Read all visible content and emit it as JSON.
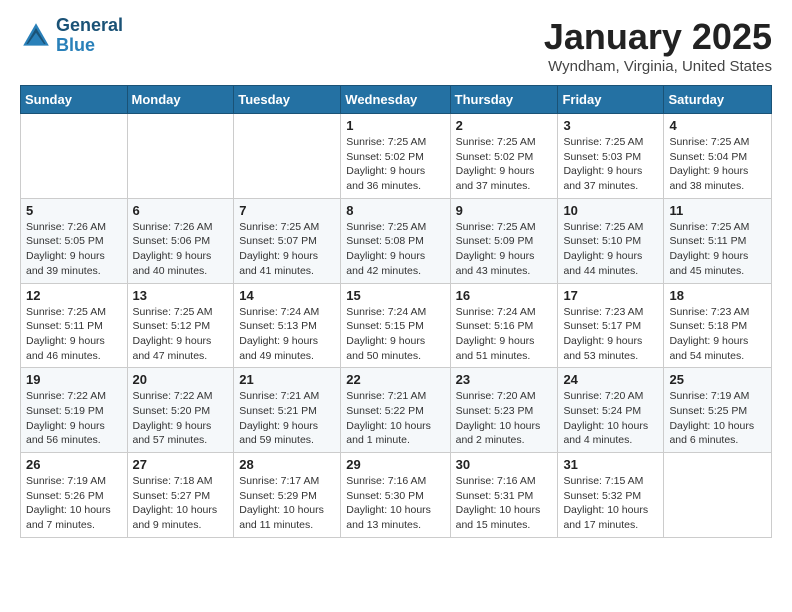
{
  "header": {
    "logo_line1": "General",
    "logo_line2": "Blue",
    "month": "January 2025",
    "location": "Wyndham, Virginia, United States"
  },
  "weekdays": [
    "Sunday",
    "Monday",
    "Tuesday",
    "Wednesday",
    "Thursday",
    "Friday",
    "Saturday"
  ],
  "weeks": [
    [
      {
        "day": "",
        "info": ""
      },
      {
        "day": "",
        "info": ""
      },
      {
        "day": "",
        "info": ""
      },
      {
        "day": "1",
        "info": "Sunrise: 7:25 AM\nSunset: 5:02 PM\nDaylight: 9 hours\nand 36 minutes."
      },
      {
        "day": "2",
        "info": "Sunrise: 7:25 AM\nSunset: 5:02 PM\nDaylight: 9 hours\nand 37 minutes."
      },
      {
        "day": "3",
        "info": "Sunrise: 7:25 AM\nSunset: 5:03 PM\nDaylight: 9 hours\nand 37 minutes."
      },
      {
        "day": "4",
        "info": "Sunrise: 7:25 AM\nSunset: 5:04 PM\nDaylight: 9 hours\nand 38 minutes."
      }
    ],
    [
      {
        "day": "5",
        "info": "Sunrise: 7:26 AM\nSunset: 5:05 PM\nDaylight: 9 hours\nand 39 minutes."
      },
      {
        "day": "6",
        "info": "Sunrise: 7:26 AM\nSunset: 5:06 PM\nDaylight: 9 hours\nand 40 minutes."
      },
      {
        "day": "7",
        "info": "Sunrise: 7:25 AM\nSunset: 5:07 PM\nDaylight: 9 hours\nand 41 minutes."
      },
      {
        "day": "8",
        "info": "Sunrise: 7:25 AM\nSunset: 5:08 PM\nDaylight: 9 hours\nand 42 minutes."
      },
      {
        "day": "9",
        "info": "Sunrise: 7:25 AM\nSunset: 5:09 PM\nDaylight: 9 hours\nand 43 minutes."
      },
      {
        "day": "10",
        "info": "Sunrise: 7:25 AM\nSunset: 5:10 PM\nDaylight: 9 hours\nand 44 minutes."
      },
      {
        "day": "11",
        "info": "Sunrise: 7:25 AM\nSunset: 5:11 PM\nDaylight: 9 hours\nand 45 minutes."
      }
    ],
    [
      {
        "day": "12",
        "info": "Sunrise: 7:25 AM\nSunset: 5:11 PM\nDaylight: 9 hours\nand 46 minutes."
      },
      {
        "day": "13",
        "info": "Sunrise: 7:25 AM\nSunset: 5:12 PM\nDaylight: 9 hours\nand 47 minutes."
      },
      {
        "day": "14",
        "info": "Sunrise: 7:24 AM\nSunset: 5:13 PM\nDaylight: 9 hours\nand 49 minutes."
      },
      {
        "day": "15",
        "info": "Sunrise: 7:24 AM\nSunset: 5:15 PM\nDaylight: 9 hours\nand 50 minutes."
      },
      {
        "day": "16",
        "info": "Sunrise: 7:24 AM\nSunset: 5:16 PM\nDaylight: 9 hours\nand 51 minutes."
      },
      {
        "day": "17",
        "info": "Sunrise: 7:23 AM\nSunset: 5:17 PM\nDaylight: 9 hours\nand 53 minutes."
      },
      {
        "day": "18",
        "info": "Sunrise: 7:23 AM\nSunset: 5:18 PM\nDaylight: 9 hours\nand 54 minutes."
      }
    ],
    [
      {
        "day": "19",
        "info": "Sunrise: 7:22 AM\nSunset: 5:19 PM\nDaylight: 9 hours\nand 56 minutes."
      },
      {
        "day": "20",
        "info": "Sunrise: 7:22 AM\nSunset: 5:20 PM\nDaylight: 9 hours\nand 57 minutes."
      },
      {
        "day": "21",
        "info": "Sunrise: 7:21 AM\nSunset: 5:21 PM\nDaylight: 9 hours\nand 59 minutes."
      },
      {
        "day": "22",
        "info": "Sunrise: 7:21 AM\nSunset: 5:22 PM\nDaylight: 10 hours\nand 1 minute."
      },
      {
        "day": "23",
        "info": "Sunrise: 7:20 AM\nSunset: 5:23 PM\nDaylight: 10 hours\nand 2 minutes."
      },
      {
        "day": "24",
        "info": "Sunrise: 7:20 AM\nSunset: 5:24 PM\nDaylight: 10 hours\nand 4 minutes."
      },
      {
        "day": "25",
        "info": "Sunrise: 7:19 AM\nSunset: 5:25 PM\nDaylight: 10 hours\nand 6 minutes."
      }
    ],
    [
      {
        "day": "26",
        "info": "Sunrise: 7:19 AM\nSunset: 5:26 PM\nDaylight: 10 hours\nand 7 minutes."
      },
      {
        "day": "27",
        "info": "Sunrise: 7:18 AM\nSunset: 5:27 PM\nDaylight: 10 hours\nand 9 minutes."
      },
      {
        "day": "28",
        "info": "Sunrise: 7:17 AM\nSunset: 5:29 PM\nDaylight: 10 hours\nand 11 minutes."
      },
      {
        "day": "29",
        "info": "Sunrise: 7:16 AM\nSunset: 5:30 PM\nDaylight: 10 hours\nand 13 minutes."
      },
      {
        "day": "30",
        "info": "Sunrise: 7:16 AM\nSunset: 5:31 PM\nDaylight: 10 hours\nand 15 minutes."
      },
      {
        "day": "31",
        "info": "Sunrise: 7:15 AM\nSunset: 5:32 PM\nDaylight: 10 hours\nand 17 minutes."
      },
      {
        "day": "",
        "info": ""
      }
    ]
  ]
}
